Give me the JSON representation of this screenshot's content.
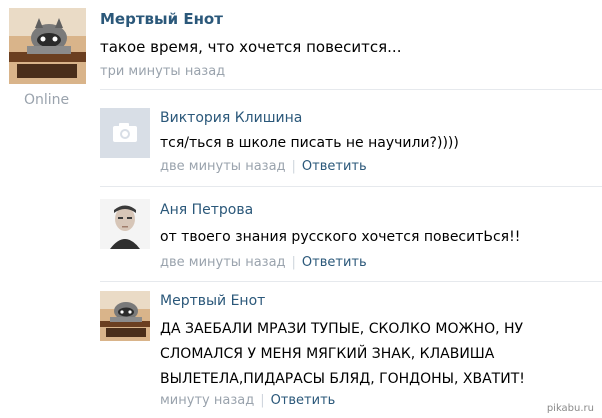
{
  "post": {
    "author": "Мертвый Енот",
    "text": "такое время, что хочется повесится...",
    "time": "три минуты назад",
    "status": "Online"
  },
  "comments": [
    {
      "author": "Виктория Клишина",
      "text": "тся/ться в школе писать не научили?))))",
      "time": "две минуты назад",
      "reply": "Ответить",
      "avatar": "camera-placeholder-icon"
    },
    {
      "author": "Аня Петрова",
      "text": "от твоего знания русского хочется повеситЬся!!",
      "time": "две минуты назад",
      "reply": "Ответить",
      "avatar": "profile-photo"
    },
    {
      "author": "Мертвый Енот",
      "lines": [
        "ДА ЗАЕБАЛИ МРАЗИ ТУПЫЕ, СКОЛКО МОЖНО, НУ",
        "СЛОМАЛСЯ У МЕНЯ МЯГКИЙ ЗНАК, КЛАВИША",
        "ВЫЛЕТЕЛА,ПИДАРАСЫ БЛЯД, ГОНДОНЫ, ХВАТИТ!"
      ],
      "time": "минуту назад",
      "reply": "Ответить",
      "avatar": "raccoon-photo"
    }
  ],
  "watermark": "pikabu.ru"
}
